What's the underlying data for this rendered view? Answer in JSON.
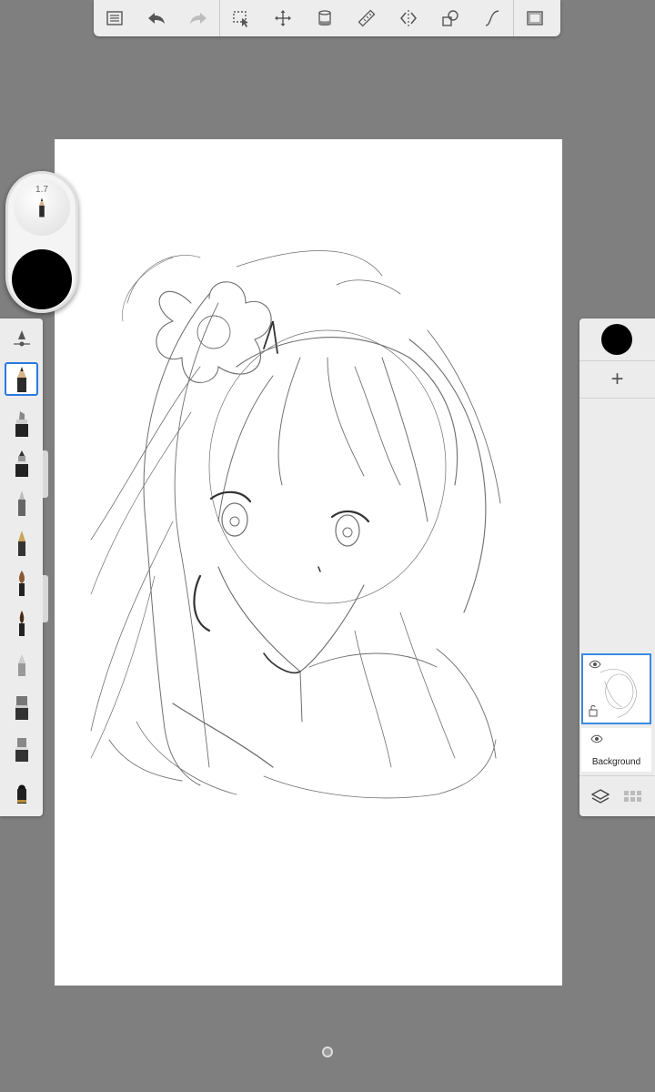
{
  "toolbar": {
    "items": [
      {
        "icon": "list-icon"
      },
      {
        "icon": "undo-icon"
      },
      {
        "icon": "redo-icon"
      },
      {
        "icon": "selection-icon"
      },
      {
        "icon": "transform-icon"
      },
      {
        "icon": "fill-bucket-icon"
      },
      {
        "icon": "ruler-icon"
      },
      {
        "icon": "symmetry-icon"
      },
      {
        "icon": "shapes-icon"
      },
      {
        "icon": "curve-icon"
      },
      {
        "icon": "fullscreen-icon"
      }
    ]
  },
  "puck": {
    "brush_size": "1.7",
    "color": "#000000"
  },
  "brushes": {
    "selected": "pencil",
    "items": [
      "brush-settings",
      "pencil",
      "marker",
      "airbrush",
      "pen",
      "fountain-pen",
      "paintbrush",
      "paintbrush-dark",
      "eraser",
      "smudge",
      "texture-brush",
      "fill-brush"
    ]
  },
  "layers": {
    "current_color": "#000000",
    "add_label": "+",
    "background_label": "Background"
  },
  "colors": {
    "accent": "#2a7ade",
    "workspace": "#7f7f7f",
    "panel": "#ececec"
  }
}
